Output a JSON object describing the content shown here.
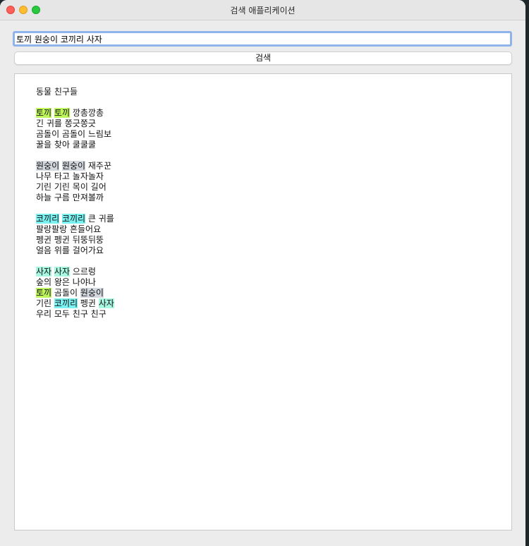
{
  "window": {
    "title": "검색 애플리케이션"
  },
  "search": {
    "value": "토끼 원숭이 코끼리 사자",
    "button_label": "검색"
  },
  "results": {
    "heading": "동물 친구들",
    "stanzas": [
      [
        [
          {
            "t": "토끼",
            "h": "green"
          },
          {
            "t": " "
          },
          {
            "t": "토끼",
            "h": "green"
          },
          {
            "t": " 깡총깡총"
          }
        ],
        [
          {
            "t": "긴 귀를 쫑긋쫑긋"
          }
        ],
        [
          {
            "t": "곰돌이 곰돌이 느림보"
          }
        ],
        [
          {
            "t": "꿀을 찾아 쿨쿨쿨"
          }
        ]
      ],
      [
        [
          {
            "t": "원숭이",
            "h": "gray"
          },
          {
            "t": " "
          },
          {
            "t": "원숭이",
            "h": "gray"
          },
          {
            "t": " 재주꾼"
          }
        ],
        [
          {
            "t": "나무 타고 놀자놀자"
          }
        ],
        [
          {
            "t": "기린 기린 목이 길어"
          }
        ],
        [
          {
            "t": "하늘 구름 만져볼까"
          }
        ]
      ],
      [
        [
          {
            "t": "코끼리",
            "h": "cyan"
          },
          {
            "t": " "
          },
          {
            "t": "코끼리",
            "h": "cyan"
          },
          {
            "t": " 큰 귀를"
          }
        ],
        [
          {
            "t": "팔랑팔랑 흔들어요"
          }
        ],
        [
          {
            "t": "펭귄 펭귄 뒤뚱뒤뚱"
          }
        ],
        [
          {
            "t": "얼음 위를 걸어가요"
          }
        ]
      ],
      [
        [
          {
            "t": "사자",
            "h": "aqua"
          },
          {
            "t": " "
          },
          {
            "t": "사자",
            "h": "aqua"
          },
          {
            "t": " 으르렁"
          }
        ],
        [
          {
            "t": "숲의 왕은 나야나"
          }
        ],
        [
          {
            "t": "토끼",
            "h": "green"
          },
          {
            "t": " 곰돌이 "
          },
          {
            "t": "원숭이",
            "h": "gray"
          }
        ],
        [
          {
            "t": "기린 "
          },
          {
            "t": "코끼리",
            "h": "cyan"
          },
          {
            "t": " 펭귄 "
          },
          {
            "t": "사자",
            "h": "aqua"
          }
        ],
        [
          {
            "t": "우리 모두 친구 친구"
          }
        ]
      ]
    ]
  },
  "colors": {
    "highlight_tokki": "#bdf55a",
    "highlight_wonsungi": "#d3d7de",
    "highlight_kokkiri": "#7af2f2",
    "highlight_saja": "#a8f7e0"
  }
}
